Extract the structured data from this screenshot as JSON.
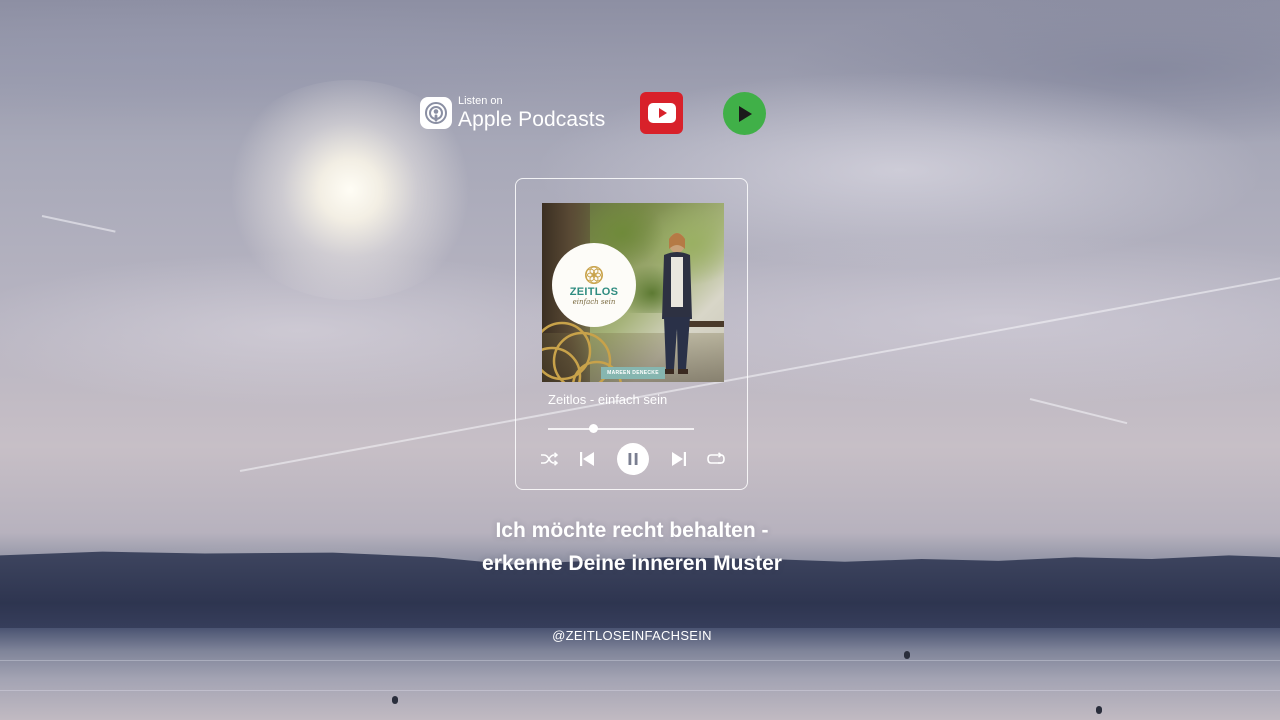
{
  "platforms": {
    "apple": {
      "small_label": "Listen on",
      "big_label": "Apple Podcasts"
    },
    "youtube": {
      "icon": "youtube-icon",
      "color": "#d8212a"
    },
    "player": {
      "icon": "play-icon",
      "color": "#40b048"
    }
  },
  "player": {
    "cover": {
      "logo_title": "ZEITLOS",
      "logo_subtitle": "einfach sein",
      "author": "MAREEN DENECKE"
    },
    "track_title": "Zeitlos - einfach sein",
    "progress": 0.31,
    "controls": {
      "shuffle": "shuffle-icon",
      "previous": "skip-previous-icon",
      "pause": "pause-icon",
      "next": "skip-next-icon",
      "repeat": "repeat-icon"
    }
  },
  "headline": {
    "line1": "Ich möchte recht behalten -",
    "line2": "erkenne Deine inneren Muster"
  },
  "handle": "@ZEITLOSEINFACHSEIN",
  "colors": {
    "accent_teal": "#2f8c80",
    "youtube_red": "#d8212a",
    "play_green": "#40b048"
  }
}
